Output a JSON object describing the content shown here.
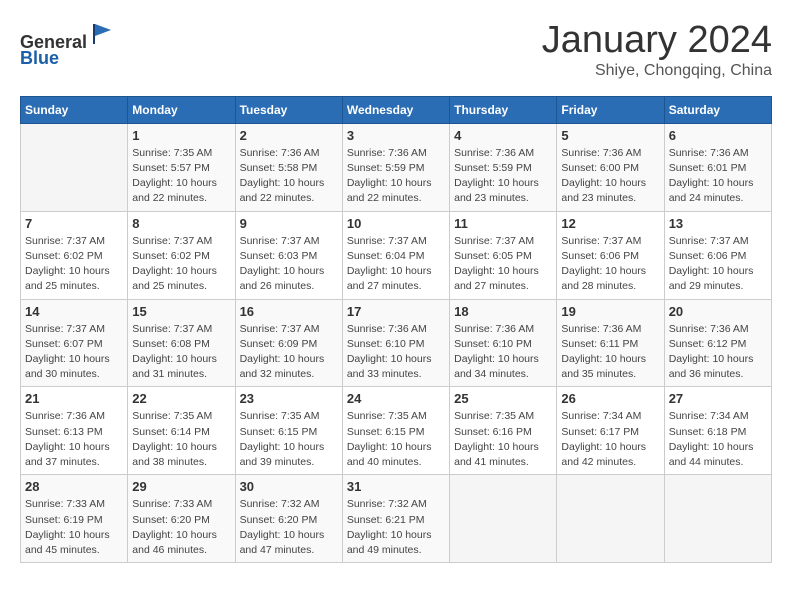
{
  "header": {
    "logo_line1": "General",
    "logo_line2": "Blue",
    "month_title": "January 2024",
    "location": "Shiye, Chongqing, China"
  },
  "days_of_week": [
    "Sunday",
    "Monday",
    "Tuesday",
    "Wednesday",
    "Thursday",
    "Friday",
    "Saturday"
  ],
  "weeks": [
    [
      {
        "day": "",
        "detail": ""
      },
      {
        "day": "1",
        "detail": "Sunrise: 7:35 AM\nSunset: 5:57 PM\nDaylight: 10 hours\nand 22 minutes."
      },
      {
        "day": "2",
        "detail": "Sunrise: 7:36 AM\nSunset: 5:58 PM\nDaylight: 10 hours\nand 22 minutes."
      },
      {
        "day": "3",
        "detail": "Sunrise: 7:36 AM\nSunset: 5:59 PM\nDaylight: 10 hours\nand 22 minutes."
      },
      {
        "day": "4",
        "detail": "Sunrise: 7:36 AM\nSunset: 5:59 PM\nDaylight: 10 hours\nand 23 minutes."
      },
      {
        "day": "5",
        "detail": "Sunrise: 7:36 AM\nSunset: 6:00 PM\nDaylight: 10 hours\nand 23 minutes."
      },
      {
        "day": "6",
        "detail": "Sunrise: 7:36 AM\nSunset: 6:01 PM\nDaylight: 10 hours\nand 24 minutes."
      }
    ],
    [
      {
        "day": "7",
        "detail": "Sunrise: 7:37 AM\nSunset: 6:02 PM\nDaylight: 10 hours\nand 25 minutes."
      },
      {
        "day": "8",
        "detail": "Sunrise: 7:37 AM\nSunset: 6:02 PM\nDaylight: 10 hours\nand 25 minutes."
      },
      {
        "day": "9",
        "detail": "Sunrise: 7:37 AM\nSunset: 6:03 PM\nDaylight: 10 hours\nand 26 minutes."
      },
      {
        "day": "10",
        "detail": "Sunrise: 7:37 AM\nSunset: 6:04 PM\nDaylight: 10 hours\nand 27 minutes."
      },
      {
        "day": "11",
        "detail": "Sunrise: 7:37 AM\nSunset: 6:05 PM\nDaylight: 10 hours\nand 27 minutes."
      },
      {
        "day": "12",
        "detail": "Sunrise: 7:37 AM\nSunset: 6:06 PM\nDaylight: 10 hours\nand 28 minutes."
      },
      {
        "day": "13",
        "detail": "Sunrise: 7:37 AM\nSunset: 6:06 PM\nDaylight: 10 hours\nand 29 minutes."
      }
    ],
    [
      {
        "day": "14",
        "detail": "Sunrise: 7:37 AM\nSunset: 6:07 PM\nDaylight: 10 hours\nand 30 minutes."
      },
      {
        "day": "15",
        "detail": "Sunrise: 7:37 AM\nSunset: 6:08 PM\nDaylight: 10 hours\nand 31 minutes."
      },
      {
        "day": "16",
        "detail": "Sunrise: 7:37 AM\nSunset: 6:09 PM\nDaylight: 10 hours\nand 32 minutes."
      },
      {
        "day": "17",
        "detail": "Sunrise: 7:36 AM\nSunset: 6:10 PM\nDaylight: 10 hours\nand 33 minutes."
      },
      {
        "day": "18",
        "detail": "Sunrise: 7:36 AM\nSunset: 6:10 PM\nDaylight: 10 hours\nand 34 minutes."
      },
      {
        "day": "19",
        "detail": "Sunrise: 7:36 AM\nSunset: 6:11 PM\nDaylight: 10 hours\nand 35 minutes."
      },
      {
        "day": "20",
        "detail": "Sunrise: 7:36 AM\nSunset: 6:12 PM\nDaylight: 10 hours\nand 36 minutes."
      }
    ],
    [
      {
        "day": "21",
        "detail": "Sunrise: 7:36 AM\nSunset: 6:13 PM\nDaylight: 10 hours\nand 37 minutes."
      },
      {
        "day": "22",
        "detail": "Sunrise: 7:35 AM\nSunset: 6:14 PM\nDaylight: 10 hours\nand 38 minutes."
      },
      {
        "day": "23",
        "detail": "Sunrise: 7:35 AM\nSunset: 6:15 PM\nDaylight: 10 hours\nand 39 minutes."
      },
      {
        "day": "24",
        "detail": "Sunrise: 7:35 AM\nSunset: 6:15 PM\nDaylight: 10 hours\nand 40 minutes."
      },
      {
        "day": "25",
        "detail": "Sunrise: 7:35 AM\nSunset: 6:16 PM\nDaylight: 10 hours\nand 41 minutes."
      },
      {
        "day": "26",
        "detail": "Sunrise: 7:34 AM\nSunset: 6:17 PM\nDaylight: 10 hours\nand 42 minutes."
      },
      {
        "day": "27",
        "detail": "Sunrise: 7:34 AM\nSunset: 6:18 PM\nDaylight: 10 hours\nand 44 minutes."
      }
    ],
    [
      {
        "day": "28",
        "detail": "Sunrise: 7:33 AM\nSunset: 6:19 PM\nDaylight: 10 hours\nand 45 minutes."
      },
      {
        "day": "29",
        "detail": "Sunrise: 7:33 AM\nSunset: 6:20 PM\nDaylight: 10 hours\nand 46 minutes."
      },
      {
        "day": "30",
        "detail": "Sunrise: 7:32 AM\nSunset: 6:20 PM\nDaylight: 10 hours\nand 47 minutes."
      },
      {
        "day": "31",
        "detail": "Sunrise: 7:32 AM\nSunset: 6:21 PM\nDaylight: 10 hours\nand 49 minutes."
      },
      {
        "day": "",
        "detail": ""
      },
      {
        "day": "",
        "detail": ""
      },
      {
        "day": "",
        "detail": ""
      }
    ]
  ]
}
